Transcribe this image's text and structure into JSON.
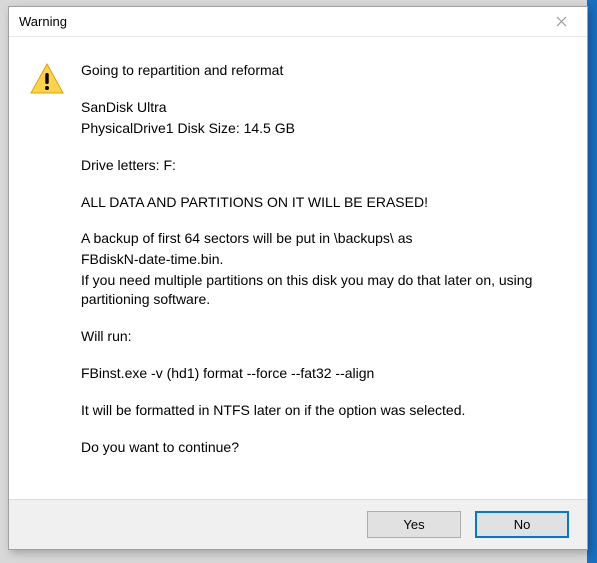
{
  "dialog": {
    "title": "Warning",
    "icon": "warning-icon",
    "heading": "Going to repartition and reformat",
    "device_name": "SanDisk Ultra",
    "drive_line": "PhysicalDrive1   Disk Size: 14.5 GB",
    "drive_letters": "Drive letters:  F:",
    "erase_warning": "ALL DATA AND PARTITIONS ON IT WILL BE ERASED!",
    "backup_line1": "A backup of first 64 sectors will be put in \\backups\\ as",
    "backup_line2": "FBdiskN-date-time.bin.",
    "backup_line3": "If you need multiple partitions on this disk you may do that later on, using partitioning software.",
    "will_run_label": "Will run:",
    "command": "FBinst.exe -v (hd1) format --force  --fat32 --align",
    "ntfs_note": "It will be formatted in NTFS later on if the option was selected.",
    "confirm_prompt": "Do you want to continue?",
    "buttons": {
      "yes": "Yes",
      "no": "No"
    }
  }
}
